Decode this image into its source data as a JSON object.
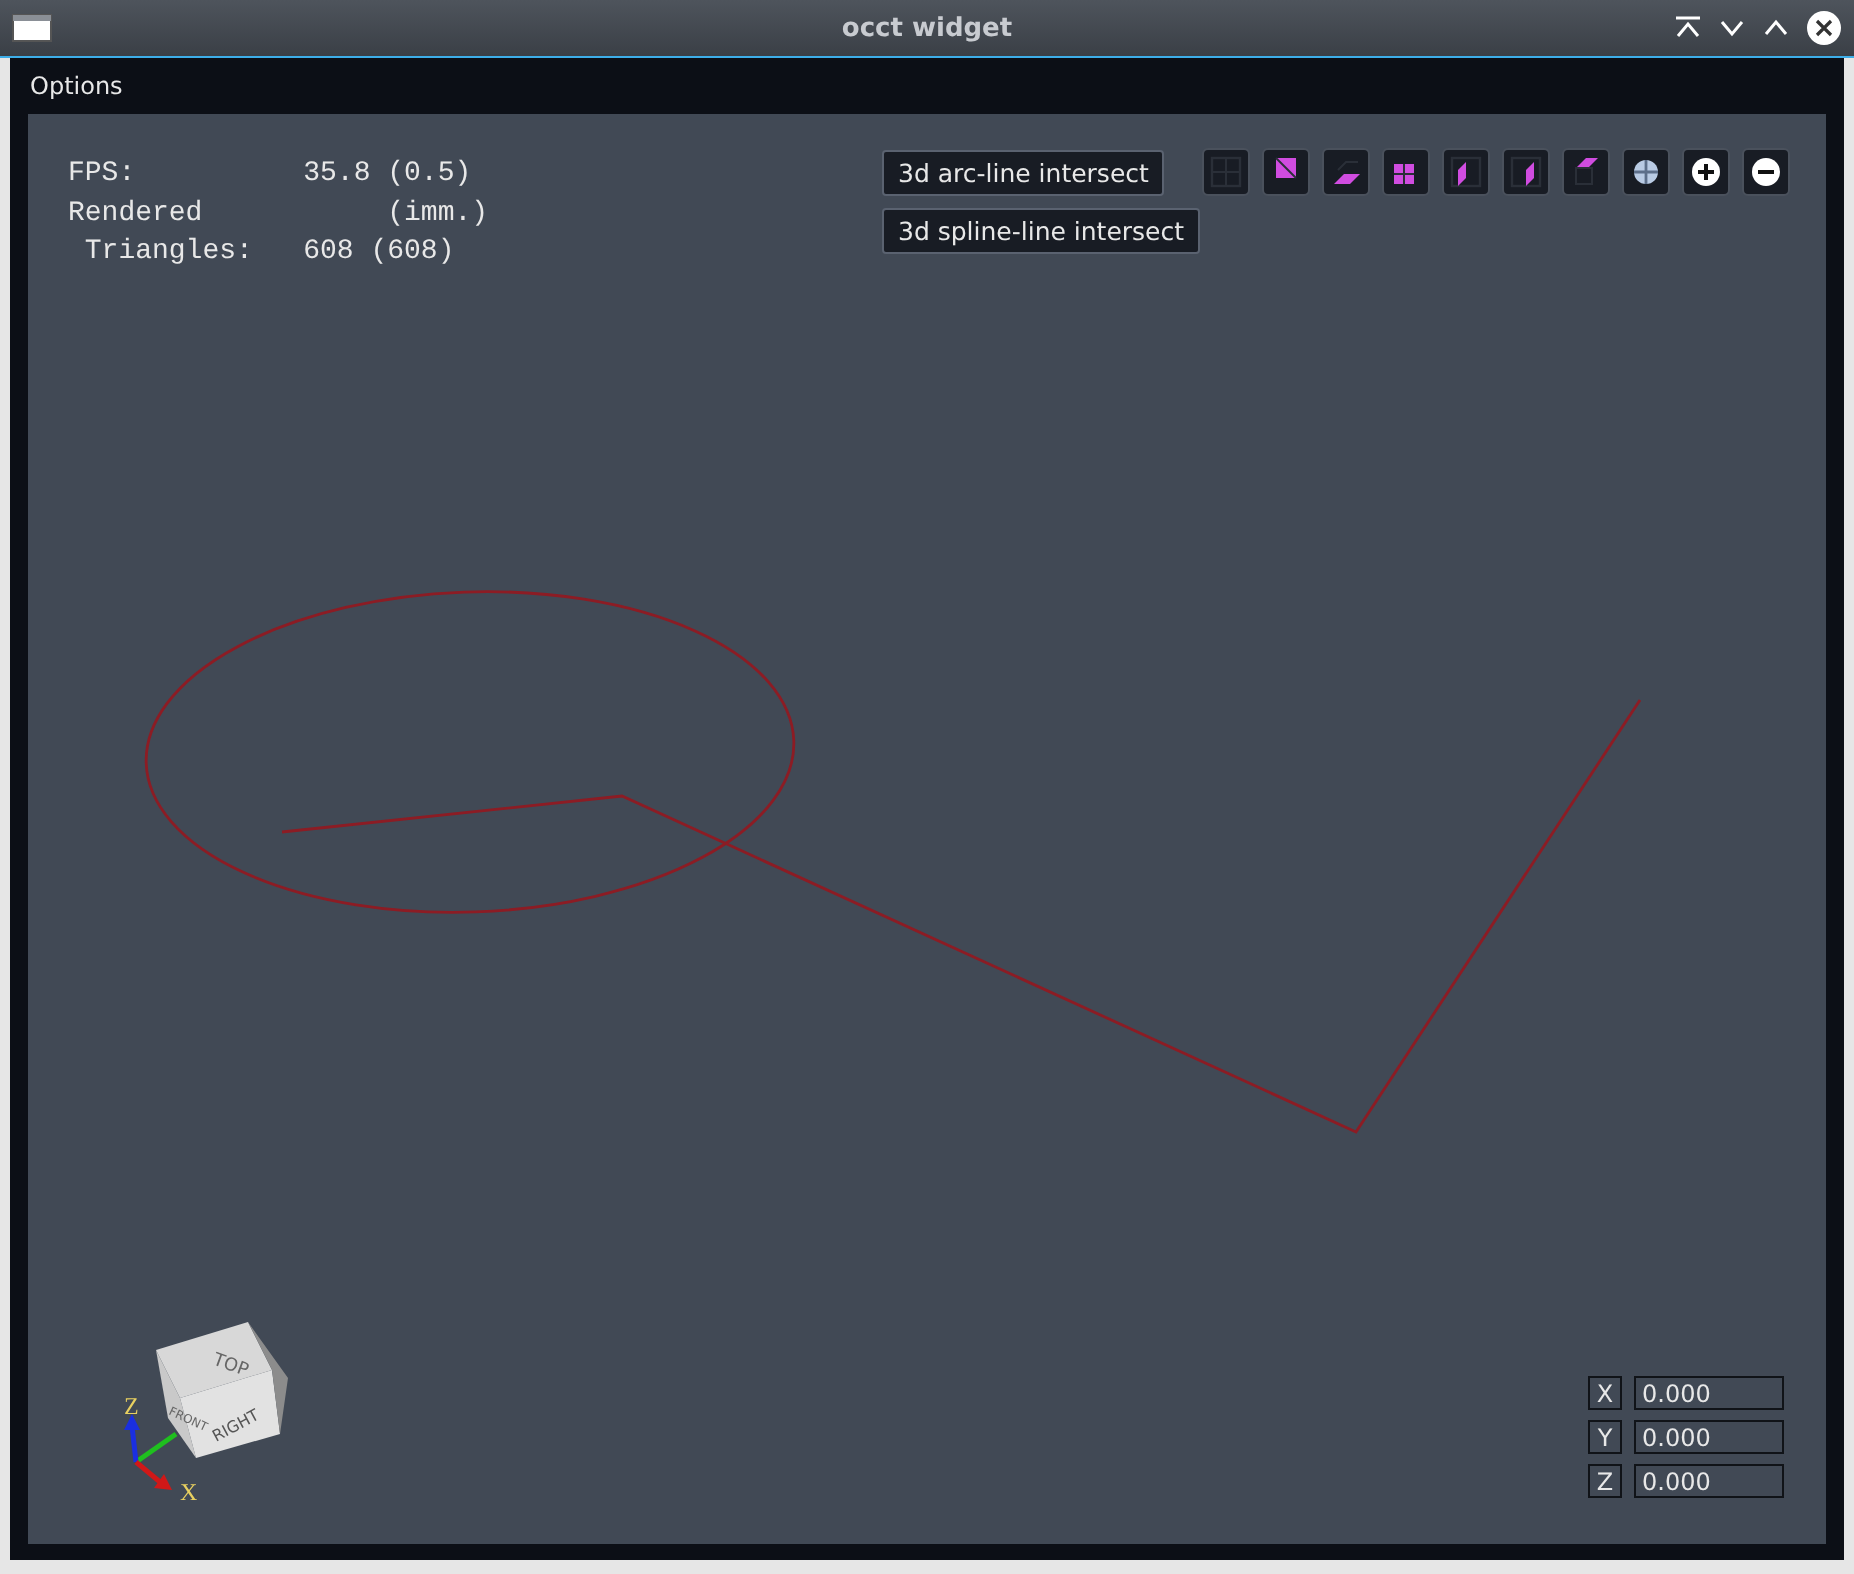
{
  "window": {
    "title": "occt widget"
  },
  "menu": [
    "Options"
  ],
  "stats": [
    "FPS:          35.8 (0.5)",
    "Rendered           (imm.)",
    " Triangles:   608 (608)"
  ],
  "buttons": [
    "3d arc-line intersect",
    "3d spline-line intersect"
  ],
  "view_buttons": [
    {
      "kind": "fit-all"
    },
    {
      "kind": "view-top"
    },
    {
      "kind": "view-bottom"
    },
    {
      "kind": "view-front"
    },
    {
      "kind": "view-left"
    },
    {
      "kind": "view-right"
    },
    {
      "kind": "view-back"
    },
    {
      "kind": "axo"
    },
    {
      "kind": "zoom-in"
    },
    {
      "kind": "zoom-out"
    }
  ],
  "view_cube": {
    "faces": [
      "TOP",
      "FRONT",
      "RIGHT"
    ],
    "axes": [
      "Z",
      "X"
    ]
  },
  "coordinates": [
    {
      "axis": "X",
      "value": "0.000"
    },
    {
      "axis": "Y",
      "value": "0.000"
    },
    {
      "axis": "Z",
      "value": "0.000"
    }
  ]
}
